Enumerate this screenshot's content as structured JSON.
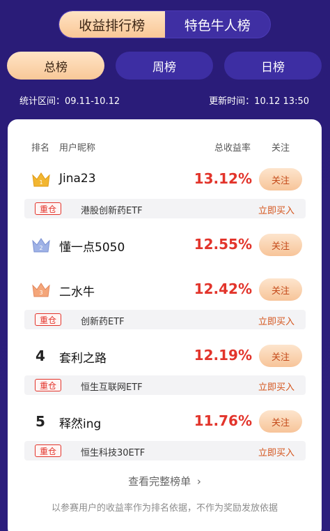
{
  "top_tabs": [
    {
      "label": "收益排行榜",
      "active": true
    },
    {
      "label": "特色牛人榜",
      "active": false
    }
  ],
  "range_tabs": [
    {
      "label": "总榜",
      "active": true
    },
    {
      "label": "周榜",
      "active": false
    },
    {
      "label": "日榜",
      "active": false
    }
  ],
  "info": {
    "period": "统计区间：09.11-10.12",
    "updated": "更新时间：10.12 13:50"
  },
  "table_header": {
    "rank": "排名",
    "nickname": "用户昵称",
    "rate": "总收益率",
    "follow": "关注"
  },
  "entries": [
    {
      "rank": "1",
      "name": "Jina23",
      "rate": "13.12%",
      "follow": "关注",
      "holding": {
        "tag": "重仓",
        "fund": "港股创新药ETF",
        "buy": "立即买入"
      }
    },
    {
      "rank": "2",
      "name": "懂一点5050",
      "rate": "12.55%",
      "follow": "关注",
      "holding": null
    },
    {
      "rank": "3",
      "name": "二水牛",
      "rate": "12.42%",
      "follow": "关注",
      "holding": {
        "tag": "重仓",
        "fund": "创新药ETF",
        "buy": "立即买入"
      }
    },
    {
      "rank": "4",
      "name": "套利之路",
      "rate": "12.19%",
      "follow": "关注",
      "holding": {
        "tag": "重仓",
        "fund": "恒生互联网ETF",
        "buy": "立即买入"
      }
    },
    {
      "rank": "5",
      "name": "释然ing",
      "rate": "11.76%",
      "follow": "关注",
      "holding": {
        "tag": "重仓",
        "fund": "恒生科技30ETF",
        "buy": "立即买入"
      }
    }
  ],
  "more_link": "查看完整榜单",
  "more_chevron": "›",
  "footnote": "以参赛用户的收益率作为排名依据，不作为奖励发放依据",
  "colors": {
    "background": "#2c1e7d",
    "accent_gold": "#f8c898",
    "rate_red": "#e2342b",
    "buy_orange": "#d4541c",
    "crown_gold": "#f2b631",
    "crown_silver": "#9fb2e6",
    "crown_bronze": "#f4a67a"
  },
  "icons": {
    "rank1": "gold-crown-icon",
    "rank2": "silver-crown-icon",
    "rank3": "bronze-crown-icon"
  }
}
